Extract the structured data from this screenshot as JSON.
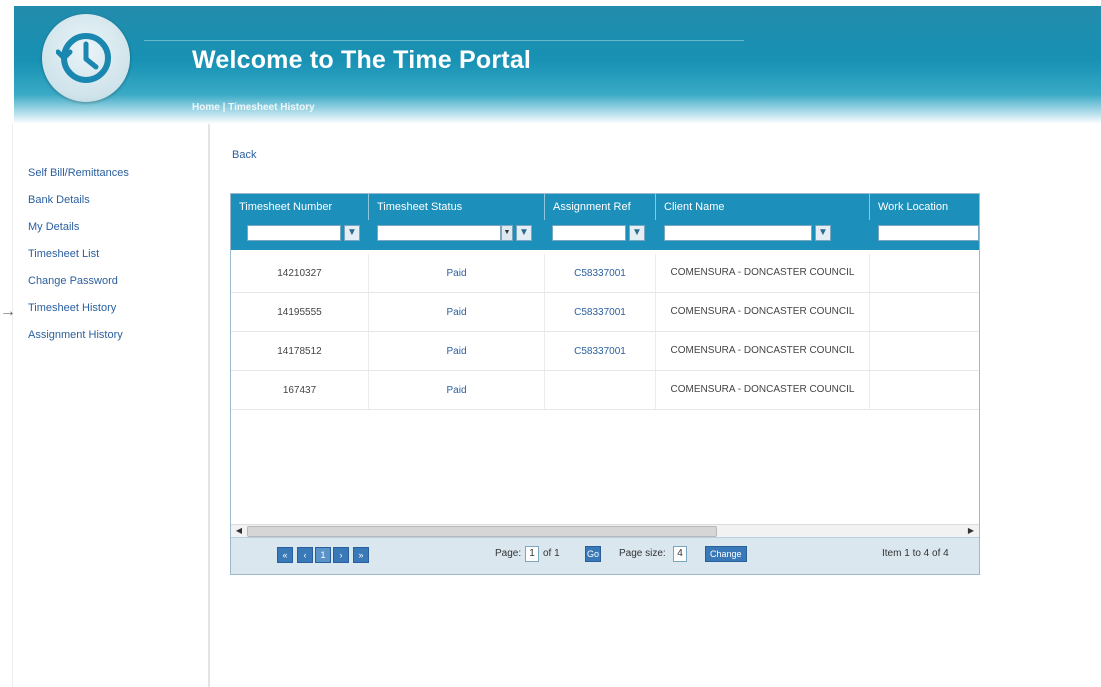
{
  "header": {
    "title": "Welcome to The Time Portal",
    "breadcrumb": {
      "home": "Home",
      "separator": " | ",
      "current": "Timesheet History"
    }
  },
  "sidebar": {
    "items": [
      {
        "label": "Self Bill/Remittances"
      },
      {
        "label": "Bank Details"
      },
      {
        "label": "My Details"
      },
      {
        "label": "Timesheet List"
      },
      {
        "label": "Change Password"
      },
      {
        "label": "Timesheet History"
      },
      {
        "label": "Assignment History"
      }
    ],
    "arrow": "→"
  },
  "main": {
    "back_label": "Back",
    "grid": {
      "columns": [
        "Timesheet Number",
        "Timesheet Status",
        "Assignment Ref",
        "Client Name",
        "Work Location"
      ],
      "rows": [
        {
          "number": "14210327",
          "status": "Paid",
          "assignment": "C58337001",
          "client": "COMENSURA - DONCASTER COUNCIL",
          "location": ""
        },
        {
          "number": "14195555",
          "status": "Paid",
          "assignment": "C58337001",
          "client": "COMENSURA - DONCASTER COUNCIL",
          "location": ""
        },
        {
          "number": "14178512",
          "status": "Paid",
          "assignment": "C58337001",
          "client": "COMENSURA - DONCASTER COUNCIL",
          "location": ""
        },
        {
          "number": "167437",
          "status": "Paid",
          "assignment": "",
          "client": "COMENSURA - DONCASTER COUNCIL",
          "location": ""
        }
      ],
      "pager": {
        "first": "«",
        "prev": "‹",
        "current_page": "1",
        "next": "›",
        "last": "»",
        "page_label": "Page:",
        "page_value": "1",
        "of_label": "of 1",
        "go": "Go",
        "size_label": "Page size:",
        "size_value": "4",
        "change": "Change",
        "summary": "Item 1 to 4 of 4"
      }
    }
  }
}
